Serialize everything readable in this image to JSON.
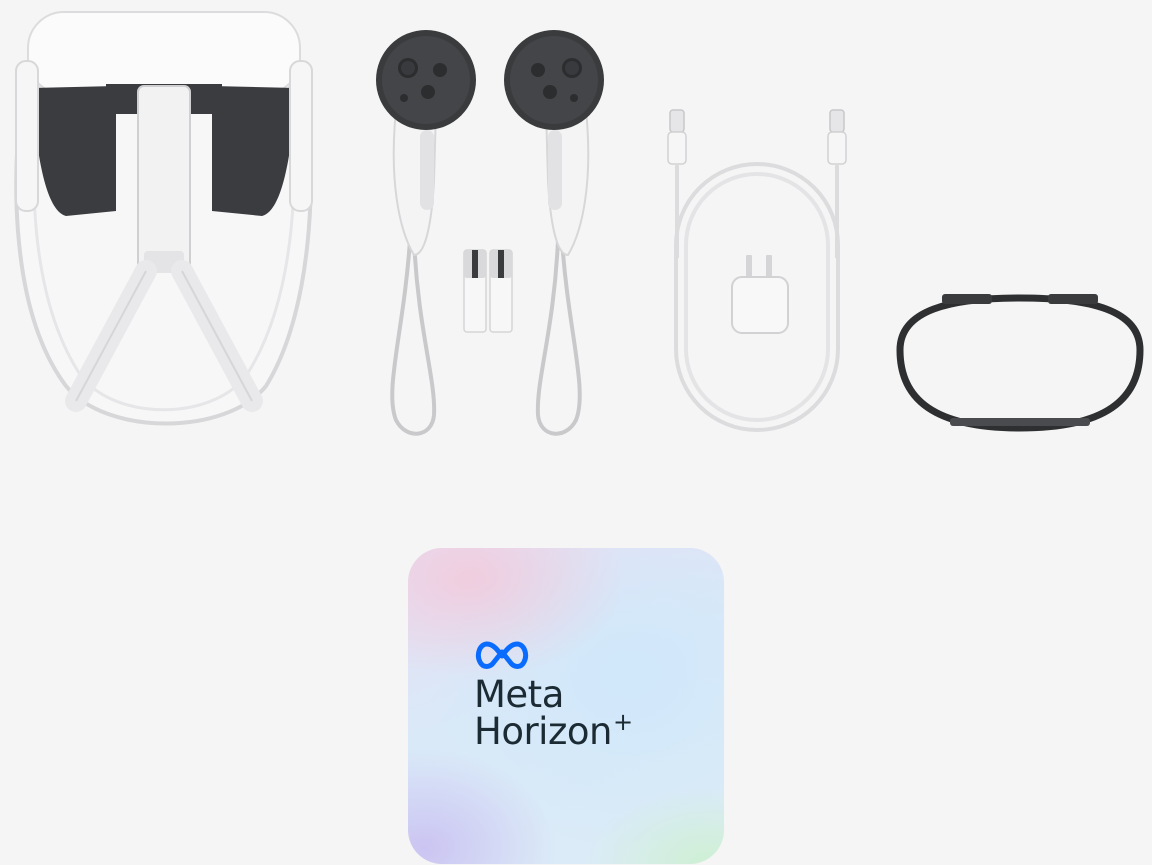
{
  "card": {
    "brand_line1": "Meta",
    "brand_line2": "Horizon",
    "brand_plus": "+",
    "logo_icon": "meta-infinity-logo",
    "logo_color": "#0a6cff",
    "text_color": "#1c2b33"
  },
  "colors": {
    "background": "#f5f5f5",
    "device_white": "#ffffff",
    "device_dark": "#3a3b3d"
  },
  "products": [
    "headset",
    "left-controller",
    "right-controller",
    "batteries",
    "usb-c-cable",
    "power-adapter",
    "facial-interface-spacer"
  ]
}
